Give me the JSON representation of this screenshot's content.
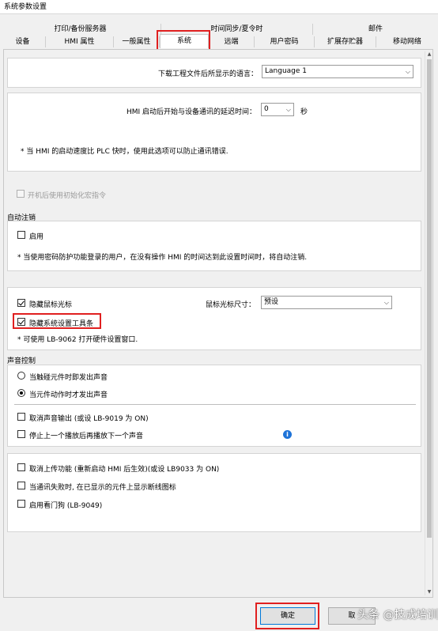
{
  "window": {
    "title": "系统参数设置"
  },
  "tabs": {
    "row1": [
      "打印/备份服务器",
      "时间同步/夏令时",
      "邮件"
    ],
    "row2": [
      "设备",
      "HMI 属性",
      "一般属性",
      "系统",
      "远端",
      "用户密码",
      "扩展存贮器",
      "移动网络"
    ],
    "active": "系统"
  },
  "language": {
    "label": "下载工程文件后所显示的语言：",
    "value": "Language 1"
  },
  "delay": {
    "label": "HMI 启动后开始与设备通讯的延迟时间：",
    "value": "0",
    "unit": "秒",
    "note": "* 当 HMI 的启动速度比 PLC 快时，使用此选项可以防止通讯错误."
  },
  "init_macro": {
    "label": "开机后使用初始化宏指令",
    "checked": false,
    "disabled": true
  },
  "auto_logout": {
    "group_title": "自动注销",
    "enable_label": "启用",
    "note": "* 当使用密码防护功能登录的用户，在没有操作 HMI 的时间达到此设置时间时，将自动注销."
  },
  "cursor": {
    "hide_cursor_label": "隐藏鼠标光标",
    "size_label": "鼠标光标尺寸：",
    "size_value": "预设",
    "hide_toolbar_label": "隐藏系统设置工具条",
    "note": "* 可使用 LB-9062 打开硬件设置窗口."
  },
  "sound": {
    "group_title": "声音控制",
    "radio1": "当触碰元件时即发出声音",
    "radio2": "当元件动作时才发出声音",
    "cb1": "取消声音输出 (或设 LB-9019 为 ON)",
    "cb2": "停止上一个播放后再播放下一个声音"
  },
  "misc": {
    "cb1": "取消上传功能 (重新启动 HMI 后生效)(或设 LB9033 为 ON)",
    "cb2": "当通讯失败时, 在已显示的元件上显示断线图标",
    "cb3": "启用看门狗 (LB-9049)"
  },
  "buttons": {
    "ok": "确定",
    "cancel": "取"
  },
  "watermark": "头条 @技成培训",
  "colors": {
    "highlight": "#e02020",
    "info": "#1e73d8",
    "focus": "#0078d7"
  }
}
